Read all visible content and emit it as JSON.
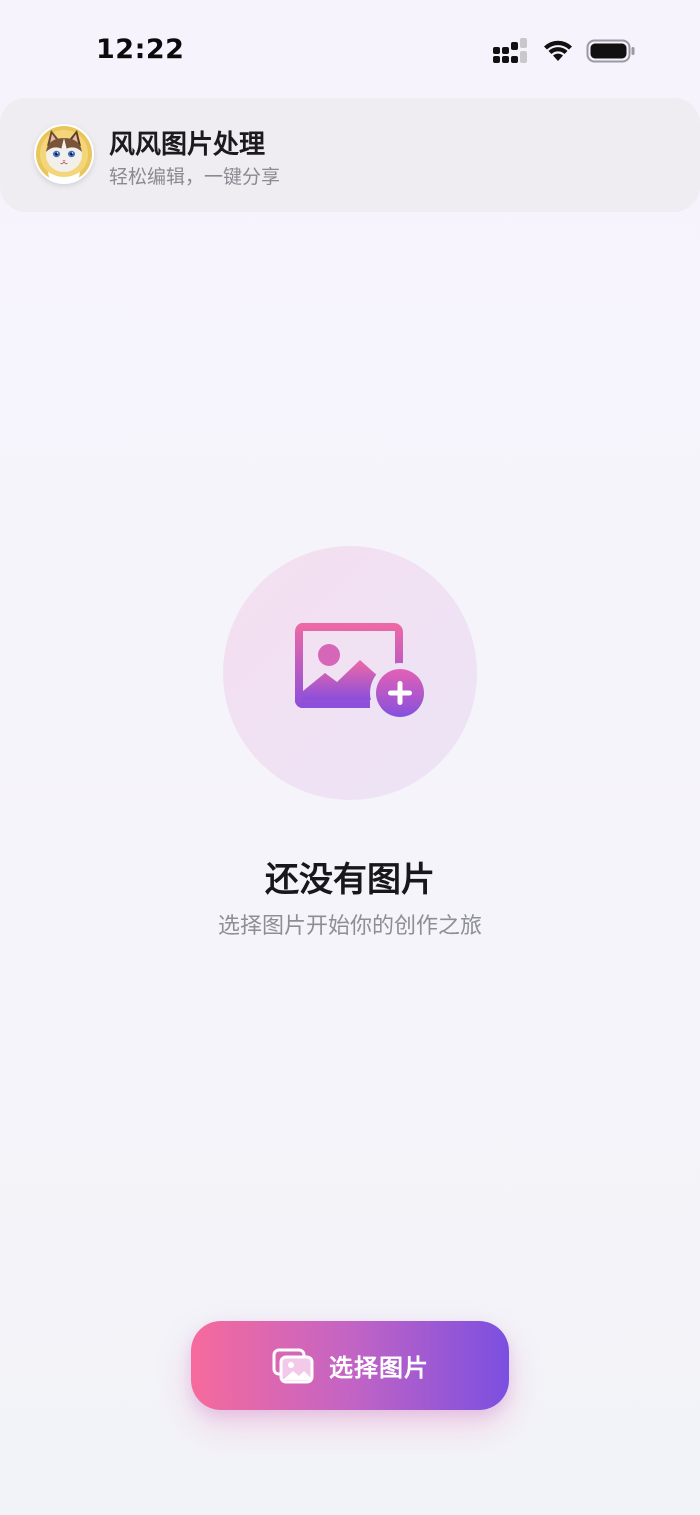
{
  "status_bar": {
    "time": "12:22",
    "icons": [
      "cellular-signal-icon",
      "wifi-icon",
      "battery-icon"
    ]
  },
  "header": {
    "title": "风风图片处理",
    "subtitle": "轻松编辑，一键分享",
    "avatar_icon": "cat-avatar-icon"
  },
  "empty_state": {
    "icon": "add-image-icon",
    "title": "还没有图片",
    "subtitle": "选择图片开始你的创作之旅"
  },
  "actions": {
    "select_button_label": "选择图片",
    "select_button_icon": "photos-icon"
  },
  "colors": {
    "accent_pink": "#f66a9c",
    "accent_purple": "#7b4fe0",
    "background": "#f6f4fb"
  }
}
